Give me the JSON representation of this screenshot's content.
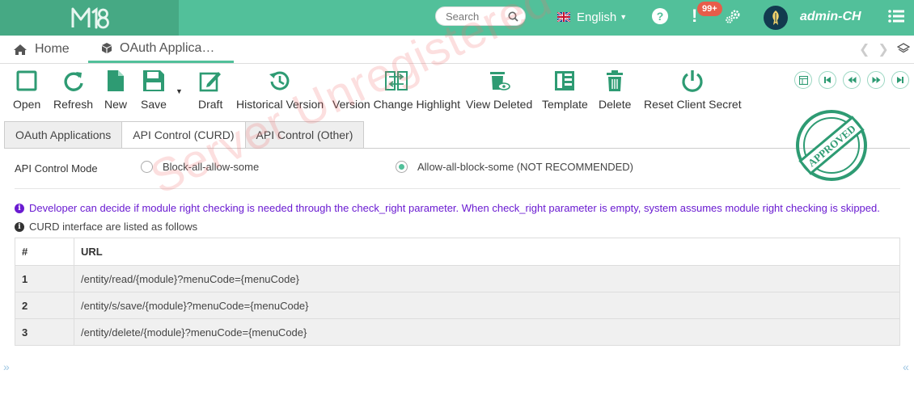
{
  "header": {
    "search_placeholder": "Search",
    "language": "English",
    "notification_count": "99+",
    "username": "admin-CH"
  },
  "page_tabs": {
    "home": "Home",
    "current": "OAuth Applica…"
  },
  "toolbar": {
    "open": "Open",
    "refresh": "Refresh",
    "new": "New",
    "save": "Save",
    "draft": "Draft",
    "historical_version": "Historical Version",
    "version_change_highlight": "Version Change Highlight",
    "view_deleted": "View Deleted",
    "template": "Template",
    "delete": "Delete",
    "reset_client_secret": "Reset Client Secret"
  },
  "form_tabs": [
    "OAuth Applications",
    "API Control (CURD)",
    "API Control (Other)"
  ],
  "api_control": {
    "label": "API Control Mode",
    "options": [
      "Block-all-allow-some",
      "Allow-all-block-some (NOT RECOMMENDED)"
    ],
    "selected": "Allow-all-block-some (NOT RECOMMENDED)"
  },
  "info": {
    "developer_note": "Developer can decide if module right checking is needed through the check_right parameter. When check_right parameter is empty, system assumes module right checking is skipped.",
    "curd_note": "CURD interface are listed as follows"
  },
  "table": {
    "columns": [
      "#",
      "URL"
    ],
    "rows": [
      {
        "no": "1",
        "url": "/entity/read/{module}?menuCode={menuCode}"
      },
      {
        "no": "2",
        "url": "/entity/s/save/{module}?menuCode={menuCode}"
      },
      {
        "no": "3",
        "url": "/entity/delete/{module}?menuCode={menuCode}"
      }
    ]
  },
  "watermark": "Server Unregistered",
  "stamp": "APPROVED",
  "colors": {
    "brand": "#52c09a",
    "brand_dark": "#46a984",
    "info_purple": "#6a1bd1",
    "badge_red": "#e85c4a"
  }
}
